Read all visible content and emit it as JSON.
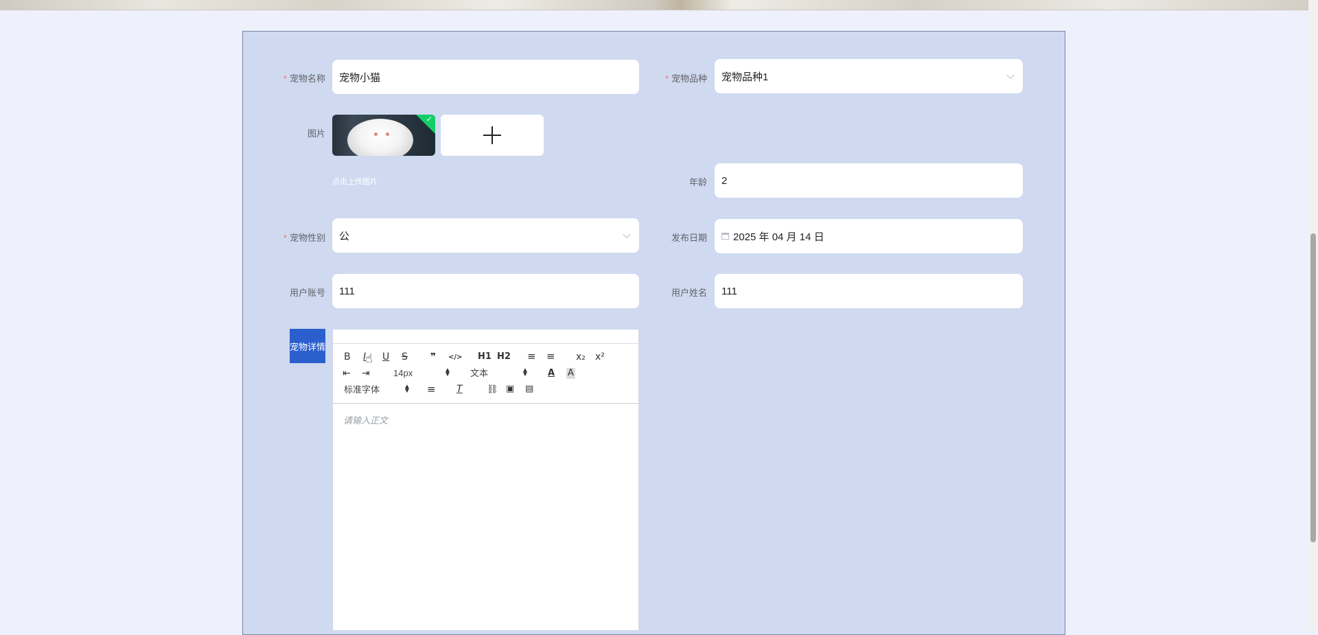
{
  "form": {
    "pet_name": {
      "label": "宠物名称",
      "required": true,
      "value": "宠物小猫"
    },
    "pet_breed": {
      "label": "宠物品种",
      "required": true,
      "value": "宠物品种1"
    },
    "image": {
      "label": "图片",
      "hint": "点击上传图片",
      "add_symbol": "+"
    },
    "age": {
      "label": "年龄",
      "value": "2"
    },
    "pet_gender": {
      "label": "宠物性别",
      "required": true,
      "value": "公"
    },
    "publish_date": {
      "label": "发布日期",
      "value": "2025 年 04 月 14 日"
    },
    "user_account": {
      "label": "用户账号",
      "value": "111"
    },
    "user_name": {
      "label": "用户姓名",
      "value": "111"
    },
    "pet_detail": {
      "label": "宠物详情"
    }
  },
  "editor": {
    "toolbar": {
      "bold": "B",
      "italic": "I",
      "underline": "U",
      "strike": "S",
      "blockquote": "❞",
      "code": "</>",
      "h1": "H1",
      "h2": "H2",
      "ordered_list": "≡",
      "bullet_list": "≡",
      "subscript": "x₂",
      "superscript": "x²",
      "outdent": "⇤",
      "indent": "⇥",
      "font_size": "14px",
      "header_type": "文本",
      "font_family": "标准字体"
    },
    "placeholder": "请输入正文"
  },
  "required_mark": "*",
  "colors": {
    "panel_bg": "#cfdaf1",
    "page_bg": "#eef0fb",
    "accent": "#2c5fce",
    "required": "#f56c6c",
    "upload_success": "#13ce66"
  }
}
